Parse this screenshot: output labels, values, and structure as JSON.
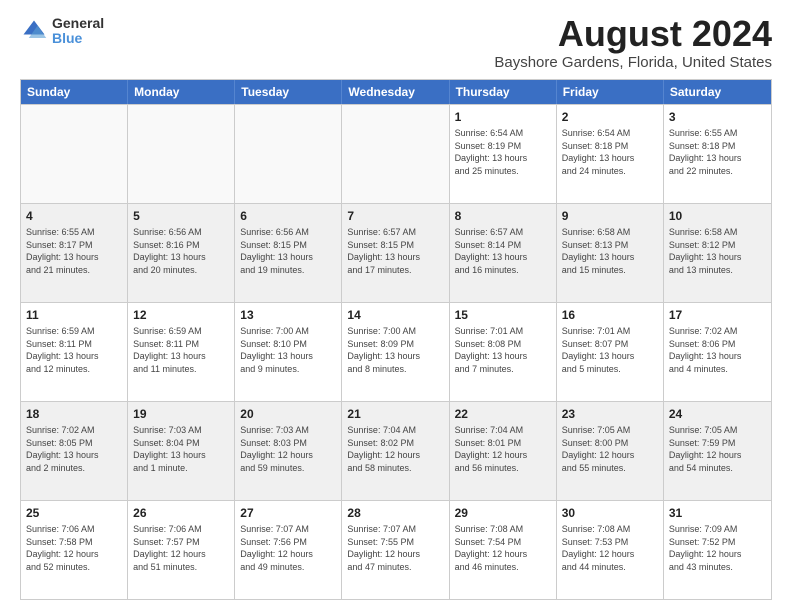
{
  "logo": {
    "general": "General",
    "blue": "Blue"
  },
  "header": {
    "title": "August 2024",
    "subtitle": "Bayshore Gardens, Florida, United States"
  },
  "weekdays": [
    "Sunday",
    "Monday",
    "Tuesday",
    "Wednesday",
    "Thursday",
    "Friday",
    "Saturday"
  ],
  "rows": [
    [
      {
        "day": "",
        "info": "",
        "empty": true
      },
      {
        "day": "",
        "info": "",
        "empty": true
      },
      {
        "day": "",
        "info": "",
        "empty": true
      },
      {
        "day": "",
        "info": "",
        "empty": true
      },
      {
        "day": "1",
        "info": "Sunrise: 6:54 AM\nSunset: 8:19 PM\nDaylight: 13 hours\nand 25 minutes.",
        "empty": false
      },
      {
        "day": "2",
        "info": "Sunrise: 6:54 AM\nSunset: 8:18 PM\nDaylight: 13 hours\nand 24 minutes.",
        "empty": false
      },
      {
        "day": "3",
        "info": "Sunrise: 6:55 AM\nSunset: 8:18 PM\nDaylight: 13 hours\nand 22 minutes.",
        "empty": false
      }
    ],
    [
      {
        "day": "4",
        "info": "Sunrise: 6:55 AM\nSunset: 8:17 PM\nDaylight: 13 hours\nand 21 minutes.",
        "empty": false
      },
      {
        "day": "5",
        "info": "Sunrise: 6:56 AM\nSunset: 8:16 PM\nDaylight: 13 hours\nand 20 minutes.",
        "empty": false
      },
      {
        "day": "6",
        "info": "Sunrise: 6:56 AM\nSunset: 8:15 PM\nDaylight: 13 hours\nand 19 minutes.",
        "empty": false
      },
      {
        "day": "7",
        "info": "Sunrise: 6:57 AM\nSunset: 8:15 PM\nDaylight: 13 hours\nand 17 minutes.",
        "empty": false
      },
      {
        "day": "8",
        "info": "Sunrise: 6:57 AM\nSunset: 8:14 PM\nDaylight: 13 hours\nand 16 minutes.",
        "empty": false
      },
      {
        "day": "9",
        "info": "Sunrise: 6:58 AM\nSunset: 8:13 PM\nDaylight: 13 hours\nand 15 minutes.",
        "empty": false
      },
      {
        "day": "10",
        "info": "Sunrise: 6:58 AM\nSunset: 8:12 PM\nDaylight: 13 hours\nand 13 minutes.",
        "empty": false
      }
    ],
    [
      {
        "day": "11",
        "info": "Sunrise: 6:59 AM\nSunset: 8:11 PM\nDaylight: 13 hours\nand 12 minutes.",
        "empty": false
      },
      {
        "day": "12",
        "info": "Sunrise: 6:59 AM\nSunset: 8:11 PM\nDaylight: 13 hours\nand 11 minutes.",
        "empty": false
      },
      {
        "day": "13",
        "info": "Sunrise: 7:00 AM\nSunset: 8:10 PM\nDaylight: 13 hours\nand 9 minutes.",
        "empty": false
      },
      {
        "day": "14",
        "info": "Sunrise: 7:00 AM\nSunset: 8:09 PM\nDaylight: 13 hours\nand 8 minutes.",
        "empty": false
      },
      {
        "day": "15",
        "info": "Sunrise: 7:01 AM\nSunset: 8:08 PM\nDaylight: 13 hours\nand 7 minutes.",
        "empty": false
      },
      {
        "day": "16",
        "info": "Sunrise: 7:01 AM\nSunset: 8:07 PM\nDaylight: 13 hours\nand 5 minutes.",
        "empty": false
      },
      {
        "day": "17",
        "info": "Sunrise: 7:02 AM\nSunset: 8:06 PM\nDaylight: 13 hours\nand 4 minutes.",
        "empty": false
      }
    ],
    [
      {
        "day": "18",
        "info": "Sunrise: 7:02 AM\nSunset: 8:05 PM\nDaylight: 13 hours\nand 2 minutes.",
        "empty": false
      },
      {
        "day": "19",
        "info": "Sunrise: 7:03 AM\nSunset: 8:04 PM\nDaylight: 13 hours\nand 1 minute.",
        "empty": false
      },
      {
        "day": "20",
        "info": "Sunrise: 7:03 AM\nSunset: 8:03 PM\nDaylight: 12 hours\nand 59 minutes.",
        "empty": false
      },
      {
        "day": "21",
        "info": "Sunrise: 7:04 AM\nSunset: 8:02 PM\nDaylight: 12 hours\nand 58 minutes.",
        "empty": false
      },
      {
        "day": "22",
        "info": "Sunrise: 7:04 AM\nSunset: 8:01 PM\nDaylight: 12 hours\nand 56 minutes.",
        "empty": false
      },
      {
        "day": "23",
        "info": "Sunrise: 7:05 AM\nSunset: 8:00 PM\nDaylight: 12 hours\nand 55 minutes.",
        "empty": false
      },
      {
        "day": "24",
        "info": "Sunrise: 7:05 AM\nSunset: 7:59 PM\nDaylight: 12 hours\nand 54 minutes.",
        "empty": false
      }
    ],
    [
      {
        "day": "25",
        "info": "Sunrise: 7:06 AM\nSunset: 7:58 PM\nDaylight: 12 hours\nand 52 minutes.",
        "empty": false
      },
      {
        "day": "26",
        "info": "Sunrise: 7:06 AM\nSunset: 7:57 PM\nDaylight: 12 hours\nand 51 minutes.",
        "empty": false
      },
      {
        "day": "27",
        "info": "Sunrise: 7:07 AM\nSunset: 7:56 PM\nDaylight: 12 hours\nand 49 minutes.",
        "empty": false
      },
      {
        "day": "28",
        "info": "Sunrise: 7:07 AM\nSunset: 7:55 PM\nDaylight: 12 hours\nand 47 minutes.",
        "empty": false
      },
      {
        "day": "29",
        "info": "Sunrise: 7:08 AM\nSunset: 7:54 PM\nDaylight: 12 hours\nand 46 minutes.",
        "empty": false
      },
      {
        "day": "30",
        "info": "Sunrise: 7:08 AM\nSunset: 7:53 PM\nDaylight: 12 hours\nand 44 minutes.",
        "empty": false
      },
      {
        "day": "31",
        "info": "Sunrise: 7:09 AM\nSunset: 7:52 PM\nDaylight: 12 hours\nand 43 minutes.",
        "empty": false
      }
    ]
  ]
}
